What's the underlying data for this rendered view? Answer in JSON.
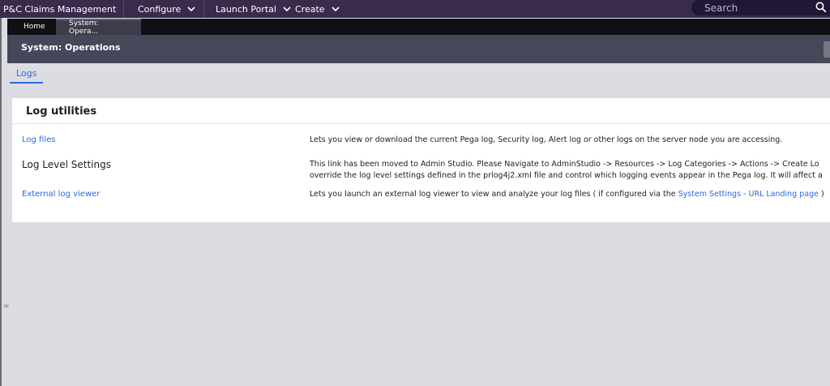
{
  "topnav": {
    "items": [
      {
        "label": "P&C Claims Management"
      },
      {
        "label": "Configure"
      },
      {
        "label": "Launch Portal"
      },
      {
        "label": "Create"
      }
    ],
    "search_placeholder": "Search"
  },
  "tabs": [
    {
      "label": "Home"
    },
    {
      "label": "System: Opera..."
    }
  ],
  "header": {
    "title": "System: Operations"
  },
  "subtabs": [
    {
      "label": "Logs"
    }
  ],
  "card": {
    "title": "Log utilities",
    "rows": [
      {
        "label": "Log files",
        "desc": "Lets you view or download the current Pega log, Security log, Alert log or other logs on the server node you are accessing."
      },
      {
        "label": "Log Level Settings",
        "desc_line1": "This link has been moved to Admin Studio. Please Navigate to AdminStudio -> Resources -> Log Categories -> Actions -> Create Lo",
        "desc_line2": "override the log level settings defined in the prlog4j2.xml file and control which logging events appear in the Pega log. It will affect a"
      },
      {
        "label": "External log viewer",
        "desc_prefix": "Lets you launch an external log viewer to view and analyze your log files ( if configured via the ",
        "desc_link": "System Settings - URL Landing page",
        "desc_suffix": " )"
      }
    ]
  },
  "colors": {
    "nav_bg": "#3a2a4c",
    "header_bg": "#47475a",
    "link": "#2d6adf",
    "page_bg": "#dcdde2"
  }
}
